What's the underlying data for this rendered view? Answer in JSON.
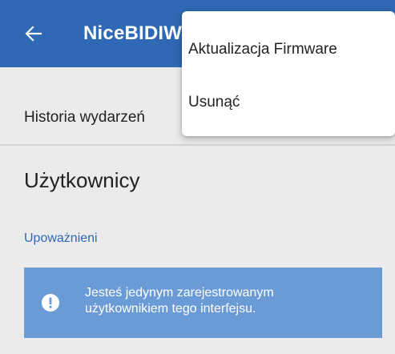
{
  "app_bar": {
    "title": "NiceBIDIW",
    "back_icon": "arrow-left-icon",
    "color": "#2f68b5"
  },
  "history": {
    "label": "Historia wydarzeń"
  },
  "users_section": {
    "title": "Użytkownicy",
    "subsection": "Upoważnieni",
    "info": {
      "icon": "exclamation-icon",
      "text": "Jesteś jedynym zarejestrowanym użytkownikiem tego interfejsu.",
      "color": "#6b9bd6"
    }
  },
  "overflow_menu": {
    "items": [
      {
        "label": "Aktualizacja Firmware"
      },
      {
        "label": "Usunąć"
      }
    ]
  }
}
